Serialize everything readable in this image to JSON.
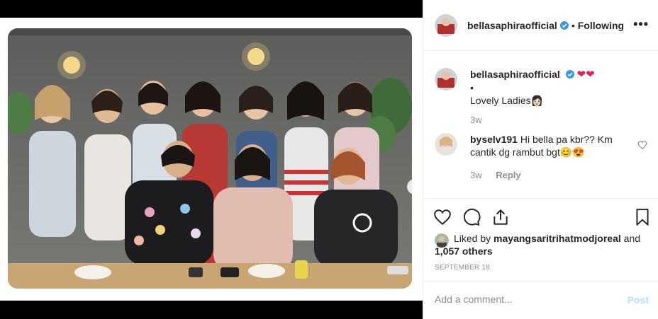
{
  "post": {
    "username": "bellasaphiraofficial",
    "follow_separator": "•",
    "follow_label": "Following",
    "more_label": "•••",
    "next_label": "›"
  },
  "caption": {
    "username": "bellasaphiraofficial",
    "emoji": "❤❤",
    "bullet": "•",
    "text": "Lovely Ladies",
    "time": "3w"
  },
  "comment": {
    "username": "byselv191",
    "text": "Hi bella pa kbr?? Km cantik dg rambut bgt",
    "emoji": "😊😍",
    "time": "3w",
    "reply_label": "Reply"
  },
  "likes": {
    "prefix": "Liked by",
    "username": "mayangsaritrihatmodjoreal",
    "conjunction": "and",
    "count": "1,057 others"
  },
  "date": "SEPTEMBER 18",
  "add_comment": {
    "placeholder": "Add a comment...",
    "post_label": "Post"
  },
  "colors": {
    "link_blue_disabled": "#b2dffc",
    "verified_blue": "#3897f0",
    "text_gray": "#8e8e8e"
  }
}
